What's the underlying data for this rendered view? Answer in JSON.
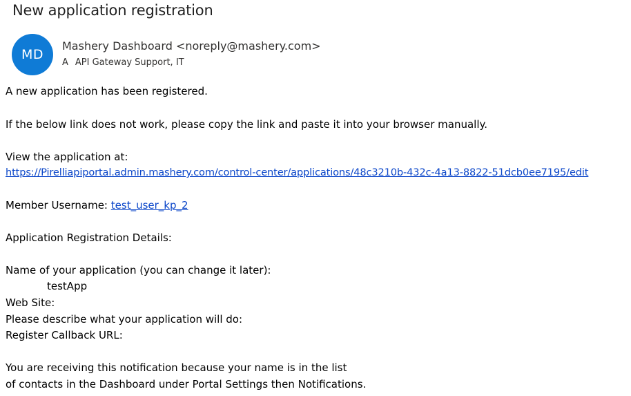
{
  "email": {
    "subject": "New application registration",
    "avatar_initials": "MD",
    "sender": "Mashery Dashboard <noreply@mashery.com>",
    "to_prefix": "A",
    "to_recipients": "API Gateway Support, IT"
  },
  "body": {
    "line1": "A new application has been registered.",
    "line2": "If the below link does not work, please copy the link and paste it into your browser manually.",
    "view_label": "View the application at:",
    "app_link": "https://Pirelliapiportal.admin.mashery.com/control-center/applications/48c3210b-432c-4a13-8822-51dcb0ee7195/edit",
    "member_label": "Member Username:",
    "member_username": "test_user_kp_2",
    "details_heading": "Application Registration Details:",
    "app_name_label": "Name of your application (you can change it later):",
    "app_name_value": "testApp",
    "website_label": "Web Site:",
    "describe_label": "Please describe what your application will do:",
    "callback_label": "Register Callback URL:",
    "footer_line1": "You are receiving this notification because your name is in the list",
    "footer_line2": "of contacts in the Dashboard under Portal Settings then Notifications."
  },
  "colors": {
    "avatar_bg": "#0f7bd6",
    "link": "#0b46c9"
  }
}
